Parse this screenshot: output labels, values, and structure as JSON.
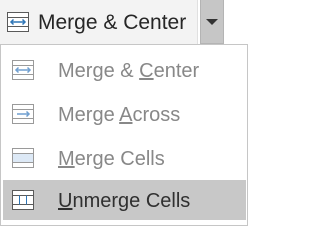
{
  "ribbon": {
    "main_button": {
      "label": "Merge & Center",
      "icon": "merge-center-icon"
    },
    "dropdown": {
      "icon": "chevron-down-icon"
    }
  },
  "menu": {
    "items": [
      {
        "pre": "Merge & ",
        "key": "C",
        "post": "enter",
        "icon": "merge-center-icon",
        "state": "disabled"
      },
      {
        "pre": "Merge ",
        "key": "A",
        "post": "cross",
        "icon": "merge-across-icon",
        "state": "disabled"
      },
      {
        "pre": "",
        "key": "M",
        "post": "erge Cells",
        "icon": "merge-cells-icon",
        "state": "disabled"
      },
      {
        "pre": "",
        "key": "U",
        "post": "nmerge Cells",
        "icon": "unmerge-cells-icon",
        "state": "highlighted"
      }
    ]
  },
  "colors": {
    "icon_blue": "#2e75b6",
    "highlight": "#c8c8c8",
    "disabled_text": "#888888"
  }
}
